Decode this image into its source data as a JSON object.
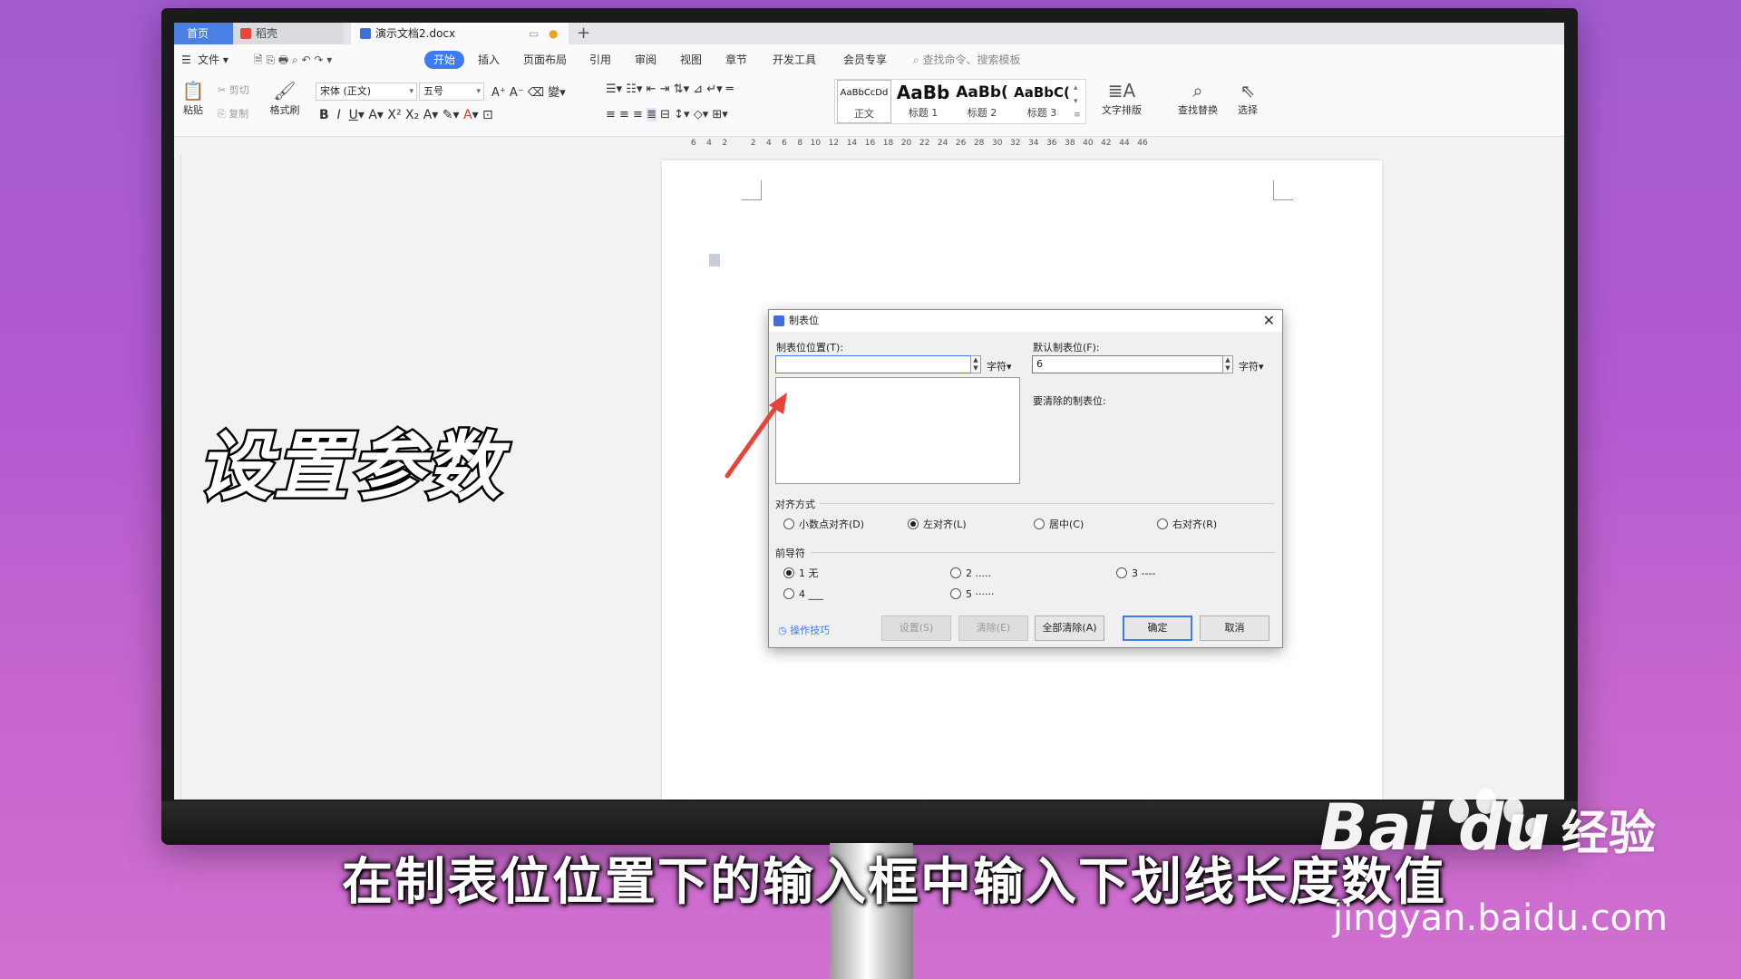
{
  "tabs": {
    "home": "首页",
    "daoke": "稻壳",
    "document": "演示文档2.docx",
    "add": "+"
  },
  "menu": {
    "file": "文件",
    "start": "开始",
    "items": [
      "插入",
      "页面布局",
      "引用",
      "审阅",
      "视图",
      "章节",
      "开发工具",
      "会员专享"
    ],
    "search_hint": "查找命令、搜索模板"
  },
  "ribbon": {
    "paste": "粘贴",
    "cut": "剪切",
    "copy": "复制",
    "format_painter": "格式刷",
    "font_name": "宋体 (正文)",
    "font_size": "五号",
    "styles": [
      {
        "sample": "AaBbCcDd",
        "caption": "正文"
      },
      {
        "sample": "AaBb",
        "caption": "标题 1"
      },
      {
        "sample": "AaBb(",
        "caption": "标题 2"
      },
      {
        "sample": "AaBbC(",
        "caption": "标题 3"
      }
    ],
    "text_layout": "文字排版",
    "find_replace": "查找替换",
    "select": "选择"
  },
  "ruler": {
    "numbers": "6    4    2         2    4    6    8   10   12   14   16   18   20   22   24   26   28   30   32   34   36   38   40   42   44   46"
  },
  "dialog": {
    "title": "制表位",
    "tab_position_label": "制表位位置(T):",
    "tab_position_value": "",
    "unit_left": "字符",
    "default_tab_label": "默认制表位(F):",
    "default_tab_value": "6",
    "unit_right": "字符",
    "to_clear_label": "要清除的制表位:",
    "alignment_label": "对齐方式",
    "alignment_options": [
      "小数点对齐(D)",
      "左对齐(L)",
      "居中(C)",
      "右对齐(R)"
    ],
    "alignment_selected": "左对齐(L)",
    "leader_label": "前导符",
    "leader_options": [
      "1 无",
      "2 .....",
      "3 ----",
      "4 ___",
      "5 ······"
    ],
    "leader_selected": "1 无",
    "tips": "操作技巧",
    "set_button": "设置(S)",
    "clear_button": "清除(E)",
    "clear_all_button": "全部清除(A)",
    "ok_button": "确定",
    "cancel_button": "取消"
  },
  "overlay": {
    "title": "设置参数",
    "subtitle": "在制表位位置下的输入框中输入下划线长度数值"
  },
  "watermark": {
    "brand": "Bai du",
    "jingyan": "经验",
    "url": "jingyan.baidu.com"
  },
  "colors": {
    "accent": "#3d7bf5",
    "arrow": "#e8433a",
    "background_top": "#a35bd0",
    "background_bottom": "#d070cf"
  }
}
